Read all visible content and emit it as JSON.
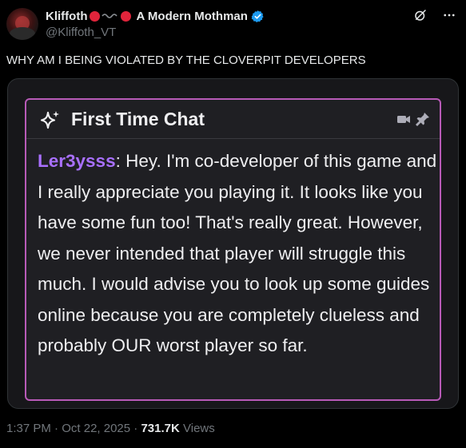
{
  "post": {
    "display_name": "Kliffoth",
    "quoted_name": "A Modern Mothman",
    "handle": "@Kliffoth_VT",
    "text": "WHY AM I BEING VIOLATED BY THE CLOVERPIT DEVELOPERS",
    "time": "1:37 PM",
    "separator": " · ",
    "date": "Oct 22, 2025",
    "views_count": "731.7K",
    "views_label": " Views"
  },
  "chat": {
    "title": "First Time Chat",
    "username": "Ler3ysss",
    "colon": ":",
    "message": " Hey. I'm co-developer of this game and I really appreciate you playing it. It looks like you have some fun too! That's really great. However, we never intended that player will struggle this much. I would advise you to look up some guides online because you are completely clueless and probably OUR worst player so far."
  },
  "icons": {
    "name_decoration": [
      "red-dot-icon",
      "wave-icon",
      "red-dot-icon"
    ],
    "verified": "verified-badge-icon",
    "grok": "grok-icon",
    "more": "more-options-icon",
    "sparkle": "sparkle-icon",
    "camera": "video-camera-icon",
    "pin": "pin-icon"
  },
  "colors": {
    "background": "#000000",
    "text": "#e7e9ea",
    "muted": "#71767b",
    "dot_red": "#e0243b",
    "verified_blue": "#1d9bf0",
    "chat_border": "#b85ab7",
    "chat_username": "#a970ff",
    "chat_bg": "#1f1f23"
  }
}
